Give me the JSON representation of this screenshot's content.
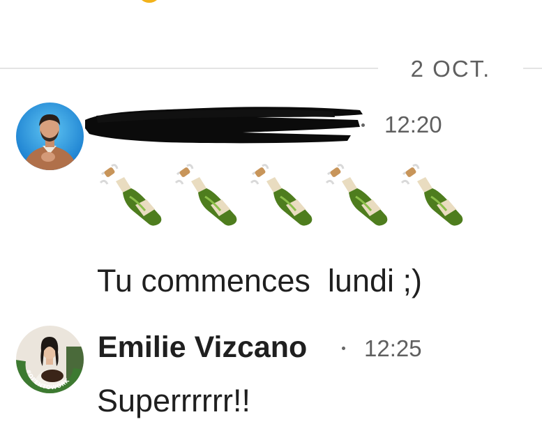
{
  "date_divider": {
    "label": "2 OCT."
  },
  "messages": [
    {
      "sender": "",
      "sender_redacted": true,
      "time": "12:20",
      "avatar": "man-avatar",
      "emoji": [
        "bottle-with-popping-cork",
        "bottle-with-popping-cork",
        "bottle-with-popping-cork",
        "bottle-with-popping-cork",
        "bottle-with-popping-cork"
      ],
      "text": "Tu commences  lundi ;)"
    },
    {
      "sender": "Emilie Vizcano",
      "time": "12:25",
      "avatar": "woman-avatar",
      "avatar_badge": "#OPENTOWORK",
      "text": "Superrrrrr!!"
    }
  ],
  "colors": {
    "opentowork_green": "#3d7a31",
    "timestamp": "#5f5f5f",
    "divider": "#e4e4e4"
  }
}
